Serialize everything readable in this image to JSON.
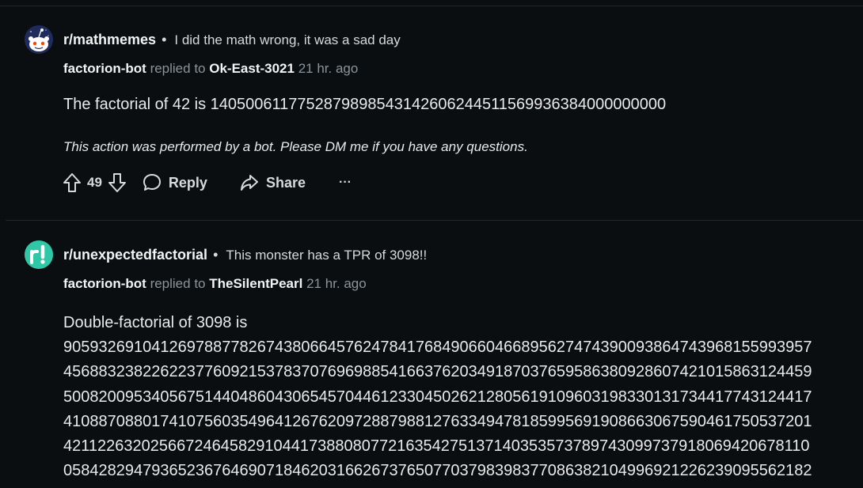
{
  "comments": [
    {
      "subreddit": "r/mathmemes",
      "post_title": "I did the math wrong, it was a sad day",
      "author": "factorion-bot",
      "replied_to_label": "replied to",
      "replied_to": "Ok-East-3021",
      "time": "21 hr. ago",
      "body": "The factorial of 42 is 1405006117752879898543142606244511569936384000000000",
      "footer": "This action was performed by a bot. Please DM me if you have any questions.",
      "score": "49",
      "reply_label": "Reply",
      "share_label": "Share",
      "more_label": "···"
    },
    {
      "subreddit": "r/unexpectedfactorial",
      "post_title": "This monster has a TPR of 3098!!",
      "author": "factorion-bot",
      "replied_to_label": "replied to",
      "replied_to": "TheSilentPearl",
      "time": "21 hr. ago",
      "body_lines": [
        "Double-factorial of 3098 is",
        "9059326910412697887782674380664576247841768490660466895627474390093864743968155993957",
        "4568832382262237760921537837076969885416637620349187037659586380928607421015863124459",
        "5008200953405675144048604306545704461233045026212805619109603198330131734417743124417",
        "4108870880174107560354964126762097288798812763349478185995691908663067590461750537201",
        "4211226320256672464582910441738808077216354275137140353573789743099737918069420678110",
        "0584282947936523676469071846203166267376507703798398377086382104996921226239095562182"
      ]
    }
  ],
  "icons": {
    "avatar1": "reddit-snoo-avatar-icon",
    "avatar2": "r-exclamation-avatar-icon",
    "upvote": "upvote-arrow-icon",
    "downvote": "downvote-arrow-icon",
    "reply": "speech-bubble-icon",
    "share": "share-arrow-icon"
  },
  "colors": {
    "background": "#0b0e10",
    "text": "#d7dadc",
    "muted": "#8a949b",
    "avatar2_bg": "#2fc7a5"
  }
}
